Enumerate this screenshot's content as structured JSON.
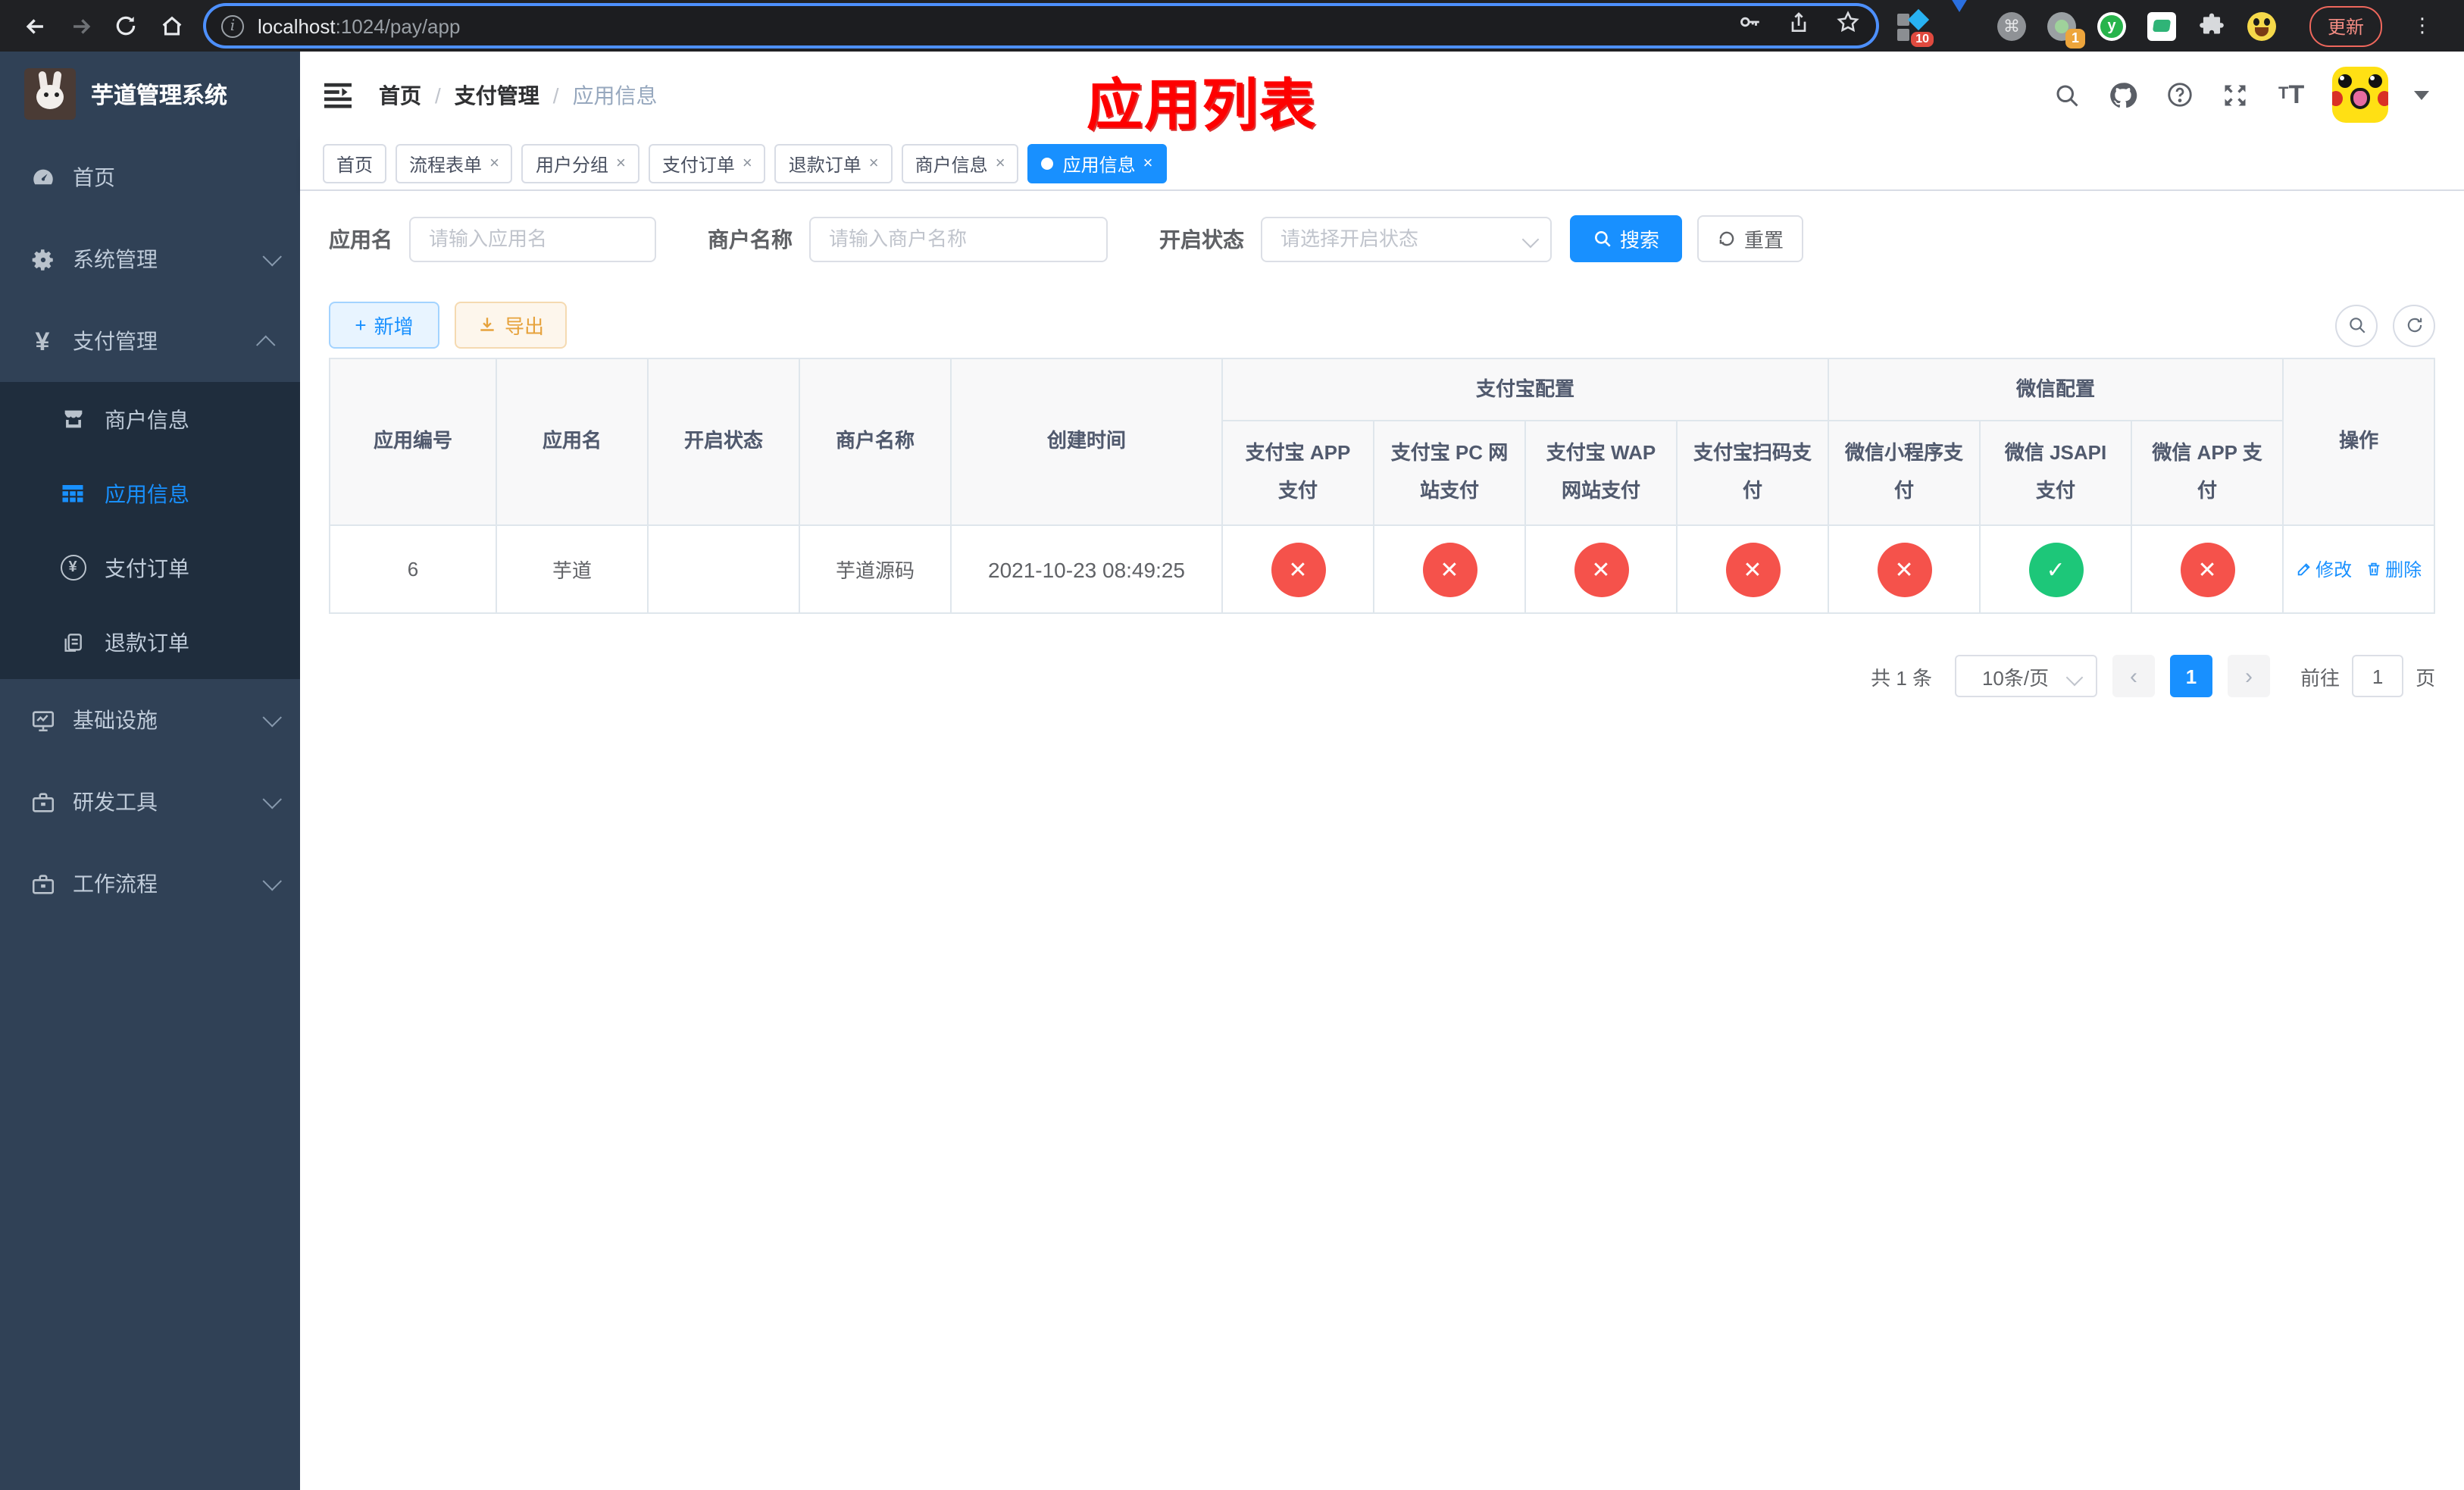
{
  "colors": {
    "primary": "#1890ff",
    "danger": "#f5524b",
    "success": "#1dc779",
    "annotation": "#fe0000"
  },
  "browser": {
    "url_host": "localhost",
    "url_rest": ":1024/pay/app",
    "ext_badge_tag": "10",
    "ext_badge_rec": "1",
    "ext_letter": "y",
    "update_label": "更新"
  },
  "sidebar": {
    "title": "芋道管理系统",
    "items": {
      "home": "首页",
      "system": "系统管理",
      "pay": "支付管理",
      "merchant": "商户信息",
      "app": "应用信息",
      "order": "支付订单",
      "refund": "退款订单",
      "infra": "基础设施",
      "dev": "研发工具",
      "workflow": "工作流程"
    },
    "pay_icon": "¥",
    "order_icon": "¥"
  },
  "header": {
    "breadcrumb": {
      "home": "首页",
      "sep1": "/",
      "group": "支付管理",
      "sep2": "/",
      "current": "应用信息"
    },
    "annotation": "应用列表",
    "font_icon_small": "T",
    "font_icon_big": "T"
  },
  "tabs": {
    "t0": "首页",
    "t1": "流程表单",
    "t2": "用户分组",
    "t3": "支付订单",
    "t4": "退款订单",
    "t5": "商户信息",
    "t6": "应用信息",
    "close": "×"
  },
  "filters": {
    "app_label": "应用名",
    "app_placeholder": "请输入应用名",
    "merchant_label": "商户名称",
    "merchant_placeholder": "请输入商户名称",
    "status_label": "开启状态",
    "status_placeholder": "请选择开启状态",
    "search_label": "搜索",
    "reset_label": "重置"
  },
  "toolbar": {
    "add_label": "新增",
    "export_label": "导出",
    "add_plus": "+"
  },
  "table": {
    "headers": {
      "id": "应用编号",
      "name": "应用名",
      "enabled": "开启状态",
      "merchant": "商户名称",
      "created": "创建时间",
      "alipay_group": "支付宝配置",
      "wechat_group": "微信配置",
      "alipay_app": "支付宝 APP 支付",
      "alipay_pc": "支付宝 PC 网站支付",
      "alipay_wap": "支付宝 WAP 网站支付",
      "alipay_qr": "支付宝扫码支付",
      "wx_lite": "微信小程序支付",
      "wx_jsapi": "微信 JSAPI 支付",
      "wx_app": "微信 APP 支付",
      "actions": "操作"
    },
    "row": {
      "id": "6",
      "name": "芋道",
      "enabled": "on",
      "merchant": "芋道源码",
      "created": "2021-10-23 08:49:25",
      "channels": {
        "alipay_app": {
          "cls": "off",
          "mark": "✕"
        },
        "alipay_pc": {
          "cls": "off",
          "mark": "✕"
        },
        "alipay_wap": {
          "cls": "off",
          "mark": "✕"
        },
        "alipay_qr": {
          "cls": "off",
          "mark": "✕"
        },
        "wx_lite": {
          "cls": "off",
          "mark": "✕"
        },
        "wx_jsapi": {
          "cls": "on",
          "mark": "✓"
        },
        "wx_app": {
          "cls": "off",
          "mark": "✕"
        }
      },
      "edit_label": "修改",
      "delete_label": "删除"
    }
  },
  "pagination": {
    "total": "共 1 条",
    "page_size": "10条/页",
    "prev": "‹",
    "page": "1",
    "next": "›",
    "goto_label": "前往",
    "goto_value": "1",
    "unit": "页"
  }
}
